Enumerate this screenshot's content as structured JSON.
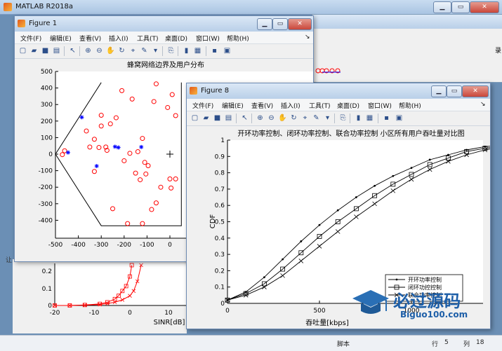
{
  "app": {
    "title": "MATLAB R2018a",
    "right_edge_text": "录",
    "status": {
      "label": "脚本",
      "row_label": "行",
      "row": "5",
      "col_label": "列",
      "col": "18"
    },
    "behind_snippet": "让"
  },
  "menu_labels": [
    "文件(F)",
    "编辑(E)",
    "查看(V)",
    "插入(I)",
    "工具(T)",
    "桌面(D)",
    "窗口(W)",
    "帮助(H)"
  ],
  "figure1": {
    "title": "Figure 1",
    "plot_title": "蜂窝网络边界及用户分布",
    "x_ticks": [
      "-500",
      "-400",
      "-300",
      "-200",
      "-100",
      "0"
    ],
    "y_ticks": [
      "500",
      "400",
      "300",
      "200",
      "100",
      "0",
      "-100",
      "-200",
      "-300",
      "-400"
    ]
  },
  "figure8": {
    "title": "Figure 8",
    "plot_title": "开环功率控制、闭环功率控制、联合功率控制 小区所有用户吞吐量对比图",
    "xlabel": "吞吐量[kbps]",
    "ylabel": "CDF",
    "x_ticks": [
      "0",
      "500",
      "1000",
      "1500"
    ],
    "y_ticks": [
      "0",
      "0.1",
      "0.2",
      "0.3",
      "0.4",
      "0.5",
      "0.6",
      "0.7",
      "0.8",
      "0.9",
      "1"
    ],
    "legend": [
      "开环功率控制",
      "闭环功控控制",
      "联合功率控制"
    ]
  },
  "behind_plot": {
    "xlabel": "SINR[dB]",
    "x_ticks": [
      "-20",
      "-10",
      "0",
      "10"
    ],
    "y_ticks": [
      "0.2",
      "0.1",
      "0"
    ]
  },
  "watermark": {
    "line1": "必过源码",
    "line2": "Biguo100.com"
  },
  "chart_data": [
    {
      "type": "scatter",
      "title": "蜂窝网络边界及用户分布",
      "xlim": [
        -500,
        50
      ],
      "ylim": [
        -450,
        500
      ],
      "boundary": [
        [
          -300,
          433
        ],
        [
          -500,
          0
        ],
        [
          -300,
          -433
        ],
        [
          50,
          -433
        ],
        [
          50,
          433
        ]
      ],
      "series": [
        {
          "marker": "o",
          "color": "#ff0000",
          "x": [
            -210,
            -165,
            -70,
            -10,
            -300,
            -60,
            -300,
            -365,
            -330,
            -350,
            -280,
            -275,
            -260,
            -235,
            -310,
            -200,
            -175,
            -120,
            -140,
            -110,
            -95,
            -105,
            -150,
            -130,
            -60,
            -80,
            -120,
            -185,
            -250,
            -460,
            -470,
            -330,
            -40,
            5,
            25,
            0,
            25,
            10
          ],
          "y": [
            384,
            333,
            318,
            282,
            235,
            425,
            170,
            140,
            90,
            43,
            43,
            23,
            183,
            220,
            40,
            -40,
            5,
            95,
            15,
            -50,
            -70,
            -120,
            -115,
            -155,
            -295,
            -335,
            -420,
            -420,
            -330,
            20,
            -3,
            -105,
            -200,
            -205,
            -150,
            -150,
            233,
            360
          ]
        },
        {
          "marker": "*",
          "color": "#0000ff",
          "x": [
            -385,
            -445,
            -320,
            -240,
            -225,
            -125
          ],
          "y": [
            223,
            10,
            -72,
            45,
            40,
            43
          ]
        }
      ]
    },
    {
      "type": "line",
      "title": "开环功率控制、闭环功率控制、联合功率控制 小区所有用户吞吐量对比图",
      "xlabel": "吞吐量[kbps]",
      "ylabel": "CDF",
      "xlim": [
        0,
        2000
      ],
      "ylim": [
        0,
        1
      ],
      "series": [
        {
          "name": "开环功率控制",
          "marker": ".",
          "x": [
            0,
            100,
            200,
            300,
            400,
            500,
            600,
            700,
            800,
            900,
            1000,
            1100,
            1200,
            1300,
            1400,
            1500,
            1600,
            1700,
            1800,
            1900,
            2000
          ],
          "y": [
            0.02,
            0.07,
            0.16,
            0.27,
            0.38,
            0.48,
            0.57,
            0.65,
            0.72,
            0.78,
            0.83,
            0.88,
            0.91,
            0.94,
            0.96,
            0.97,
            0.98,
            0.985,
            0.99,
            0.995,
            1.0
          ]
        },
        {
          "name": "闭环功控控制",
          "marker": "s",
          "x": [
            0,
            100,
            200,
            300,
            400,
            500,
            600,
            700,
            800,
            900,
            1000,
            1100,
            1200,
            1300,
            1400,
            1500,
            1600,
            1700,
            1800,
            1900,
            2000
          ],
          "y": [
            0.02,
            0.06,
            0.12,
            0.21,
            0.31,
            0.41,
            0.5,
            0.58,
            0.66,
            0.73,
            0.79,
            0.85,
            0.89,
            0.93,
            0.95,
            0.965,
            0.975,
            0.985,
            0.99,
            0.995,
            1.0
          ]
        },
        {
          "name": "联合功率控制",
          "marker": "x",
          "x": [
            0,
            100,
            200,
            300,
            400,
            500,
            600,
            700,
            800,
            900,
            1000,
            1100,
            1200,
            1300,
            1400,
            1500,
            1600,
            1700,
            1800,
            1900,
            2000
          ],
          "y": [
            0.02,
            0.05,
            0.1,
            0.17,
            0.26,
            0.35,
            0.44,
            0.53,
            0.61,
            0.69,
            0.76,
            0.82,
            0.87,
            0.91,
            0.94,
            0.96,
            0.97,
            0.98,
            0.99,
            0.995,
            1.0
          ]
        }
      ]
    },
    {
      "type": "line",
      "xlabel": "SINR[dB]",
      "xlim": [
        -20,
        15
      ],
      "ylim": [
        0,
        0.25
      ],
      "series": [
        {
          "color": "#ff0000",
          "marker": "s",
          "x": [
            -20,
            -16,
            -12,
            -8,
            -6,
            -4,
            -3,
            -2,
            -1,
            0,
            0.5
          ],
          "y": [
            0.0,
            0.0,
            0.003,
            0.01,
            0.02,
            0.04,
            0.06,
            0.09,
            0.12,
            0.18,
            0.25
          ]
        },
        {
          "color": "#ff0000",
          "marker": "x",
          "x": [
            -20,
            -16,
            -12,
            -8,
            -6,
            -4,
            -2,
            0,
            1,
            2,
            3
          ],
          "y": [
            0.0,
            0.0,
            0.002,
            0.006,
            0.012,
            0.02,
            0.035,
            0.06,
            0.09,
            0.15,
            0.25
          ]
        }
      ]
    }
  ]
}
